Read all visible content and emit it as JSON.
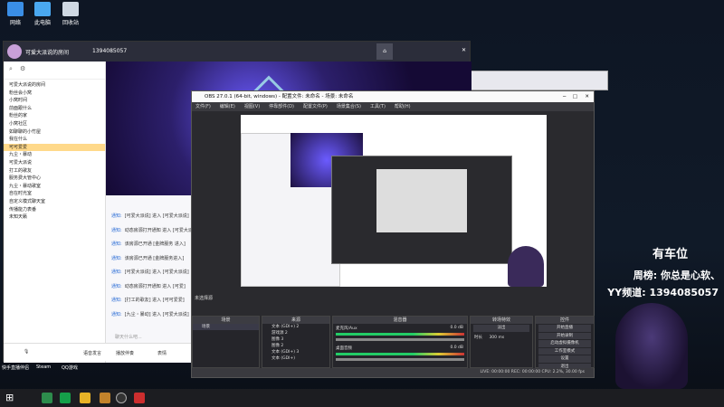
{
  "desktop_icons": [
    {
      "label": "网络"
    },
    {
      "label": "此电脑"
    },
    {
      "label": "回收站"
    }
  ],
  "yy": {
    "title": "可爱大派说的房间",
    "id": "1394085057",
    "rooms": [
      "可爱大派说的房间",
      "粉丝会小窝",
      "小窝时间",
      "前面跟什么",
      "粉丝的家",
      "小窝社区",
      "如聊聊的小竹屋",
      "我在什么",
      "可可爱爱",
      "九尘・暴动",
      "可爱大派说",
      "打工的歌友",
      "服务费大管中心",
      "九尘・暴动歌室",
      "自在时光室",
      "自定义模式聊天室",
      "传播能力表番",
      "未知天籁"
    ],
    "chat": [
      {
        "n": "通知:",
        "t": "[可爱大派说] 进入 [可爱大派说]"
      },
      {
        "n": "通知:",
        "t": "动态房源打开通知 进入 [可爱大派说]"
      },
      {
        "n": "通知:",
        "t": "该房源已开通 [金牌服务 进入]"
      },
      {
        "n": "通知:",
        "t": "该房源已开通 [金牌服务进入]"
      },
      {
        "n": "通知:",
        "t": "[可爱大派说] 进入 [可爱大派说]"
      },
      {
        "n": "通知:",
        "t": "动态房源打开通知 进入 [可爱]"
      },
      {
        "n": "通知:",
        "t": "[打工的歌友] 进入 [可可爱爱]"
      },
      {
        "n": "通知:",
        "t": "[九尘・暴动] 进入 [可爱大派说]"
      }
    ],
    "input_placeholder": "聊天什么吧...",
    "bottom": [
      "语音发言",
      "播放伴奏",
      "表情"
    ]
  },
  "obs": {
    "title": "OBS 27.0.1 (64-bit, windows) - 配置文件: 未命名 - 场景: 未命名",
    "menu": [
      "文件(F)",
      "编辑(E)",
      "视图(V)",
      "停靠部件(D)",
      "配置文件(P)",
      "场景集合(S)",
      "工具(T)",
      "帮助(H)"
    ],
    "no_source": "未选择源",
    "panels": {
      "scenes": "场景",
      "sources": "来源",
      "mixer": "混音器",
      "transitions": "转场特效",
      "controls": "控件"
    },
    "scene_items": [
      "场景"
    ],
    "source_items": [
      "文本 (GDI+) 2",
      "游戏源 2",
      "图像 3",
      "图像 2",
      "文本 (GDI+) 3",
      "文本 (GDI+)"
    ],
    "mixer": [
      {
        "name": "麦克风/Aux",
        "db": "0.0 dB"
      },
      {
        "name": "桌面音频",
        "db": "0.0 dB"
      }
    ],
    "transition": {
      "type": "淡出",
      "duration_label": "时长",
      "duration": "300 ms"
    },
    "controls": [
      "开始直播",
      "开始录制",
      "启动虚拟摄像机",
      "工作室模式",
      "设置",
      "退出"
    ],
    "status": "LIVE: 00:00:00    REC: 00:00:00    CPU: 2.2%, 30.00 fps"
  },
  "overlay": {
    "line1": "有车位",
    "line2": "周榜: 你总是心软、",
    "line3": "YY频道: 1394085057"
  },
  "taskbar_labels": [
    "快手直播伴侣",
    "Steam",
    "QQ游戏"
  ]
}
